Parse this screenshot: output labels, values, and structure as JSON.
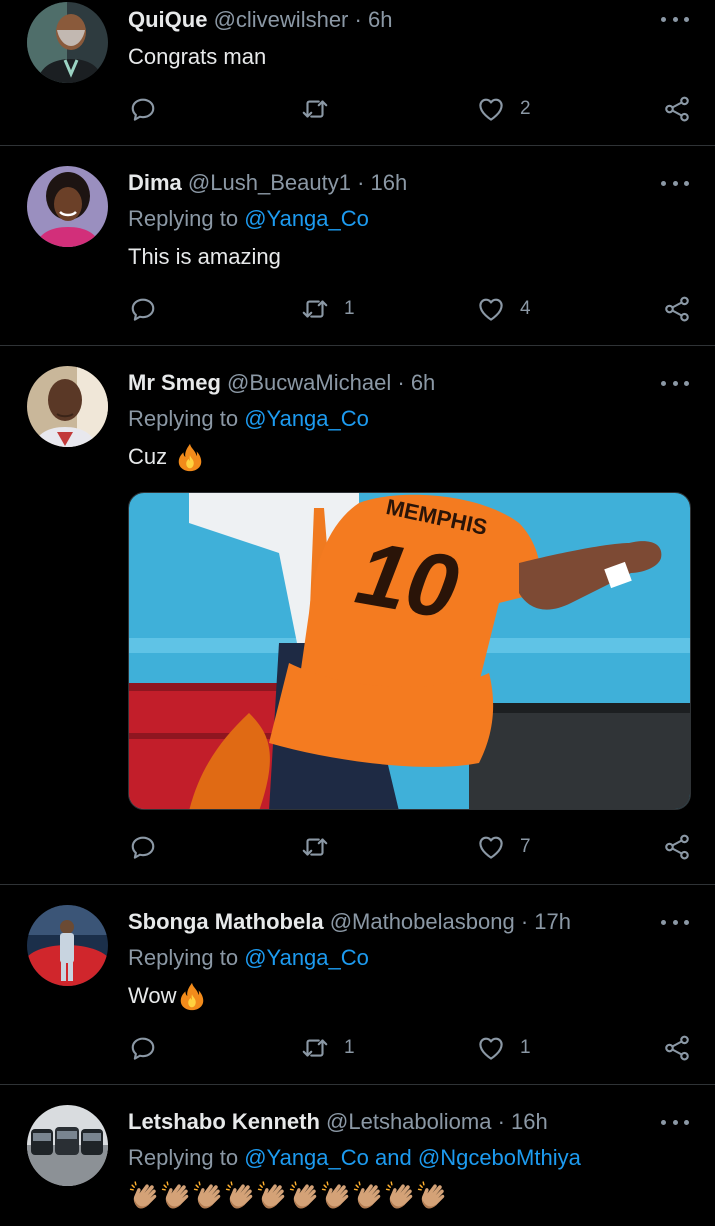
{
  "replying_prefix": "Replying to",
  "tweets": [
    {
      "name": "QuiQue",
      "handle": "@clivewilsher",
      "dot": "·",
      "time": "6h",
      "text": "Congrats man",
      "reply_count": "",
      "retweet_count": "",
      "like_count": "2"
    },
    {
      "name": "Dima",
      "handle": "@Lush_Beauty1",
      "dot": "·",
      "time": "16h",
      "replying_to": "@Yanga_Co",
      "text": "This is amazing",
      "reply_count": "",
      "retweet_count": "1",
      "like_count": "4"
    },
    {
      "name": "Mr Smeg",
      "handle": "@BucwaMichael",
      "dot": "·",
      "time": "6h",
      "replying_to": "@Yanga_Co",
      "text": "Cuz",
      "emoji": "fire",
      "media_jersey_name": "MEMPHIS",
      "media_jersey_number": "10",
      "reply_count": "",
      "retweet_count": "",
      "like_count": "7"
    },
    {
      "name": "Sbonga Mathobela",
      "handle": "@Mathobelasbong",
      "dot": "·",
      "time": "17h",
      "replying_to": "@Yanga_Co",
      "text": "Wow",
      "emoji": "fire",
      "reply_count": "",
      "retweet_count": "1",
      "like_count": "1"
    },
    {
      "name": "Letshabo Kenneth",
      "handle": "@Letshabolioma",
      "dot": "·",
      "time": "16h",
      "replying_to": "@Yanga_Co",
      "replying_and": "and",
      "replying_to_2": "@NgceboMthiya",
      "emoji": "clapping-hands",
      "emoji_count": 10
    }
  ],
  "colors": {
    "background": "#000000",
    "text": "#e7e9ea",
    "secondary": "#8b98a5",
    "accent": "#1d9bf0",
    "divider": "#2f3336"
  },
  "icons": [
    "reply-icon",
    "retweet-icon",
    "like-icon",
    "share-icon",
    "more-icon"
  ]
}
